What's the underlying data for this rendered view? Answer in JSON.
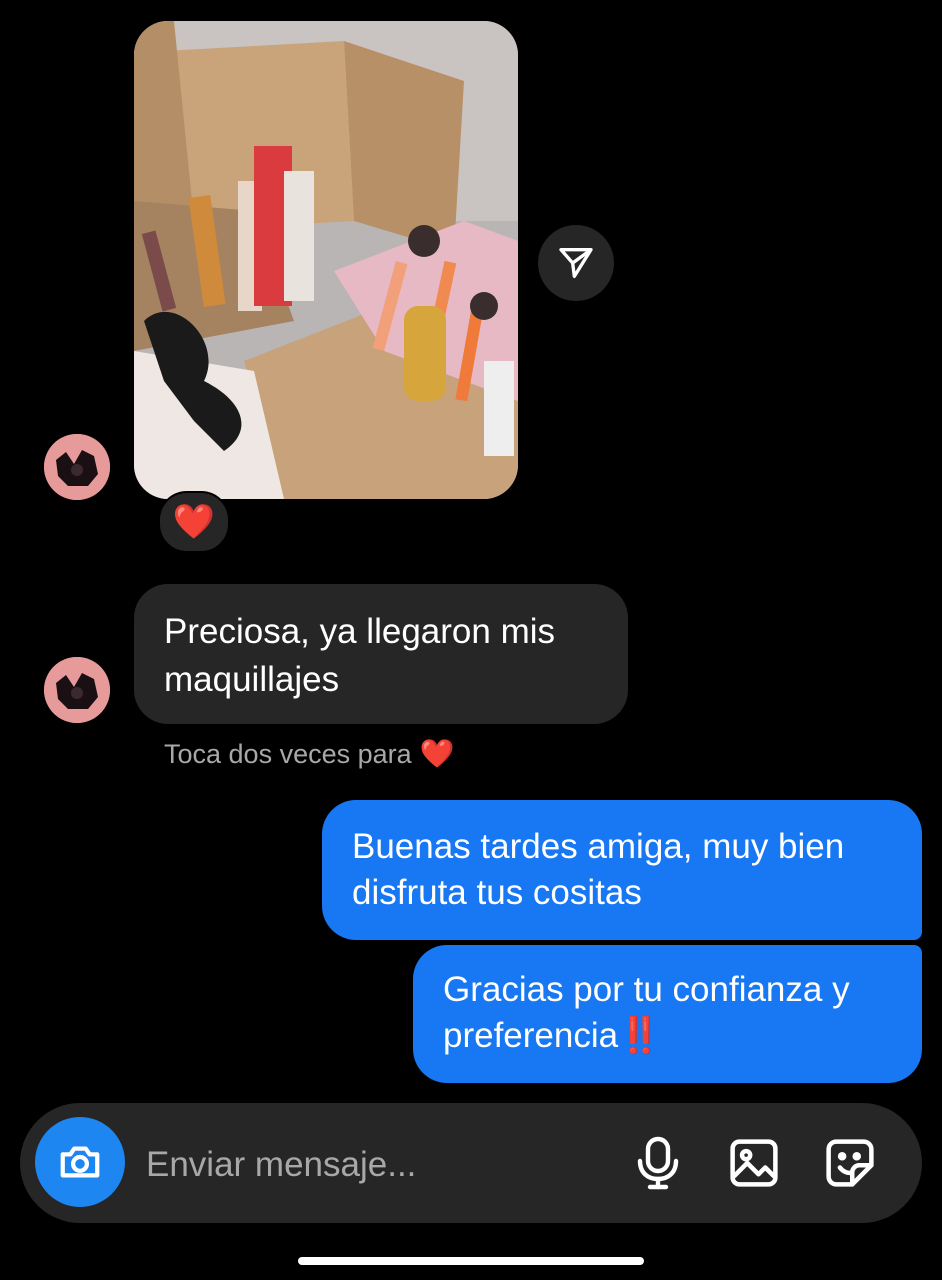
{
  "thread": {
    "image_message": {
      "description_icon": "makeup-box-photo",
      "reaction": "❤️"
    },
    "incoming_text": "Preciosa, ya llegaron mis maquillajes",
    "hint": {
      "text": "Toca dos veces para",
      "emoji": "❤️"
    },
    "outgoing": [
      {
        "text": "Buenas tardes amiga, muy bien disfruta tus cositas"
      },
      {
        "text": "Gracias por tu confianza y preferencia",
        "emoji": "‼️"
      }
    ]
  },
  "composer": {
    "placeholder": "Enviar mensaje...",
    "icons": [
      "camera-icon",
      "microphone-icon",
      "gallery-icon",
      "sticker-icon"
    ]
  },
  "colors": {
    "background": "#000000",
    "incoming_bubble": "#262626",
    "outgoing_bubble": "#1877f2",
    "camera_button": "#1d86f0",
    "muted_text": "#a8a8a8"
  }
}
